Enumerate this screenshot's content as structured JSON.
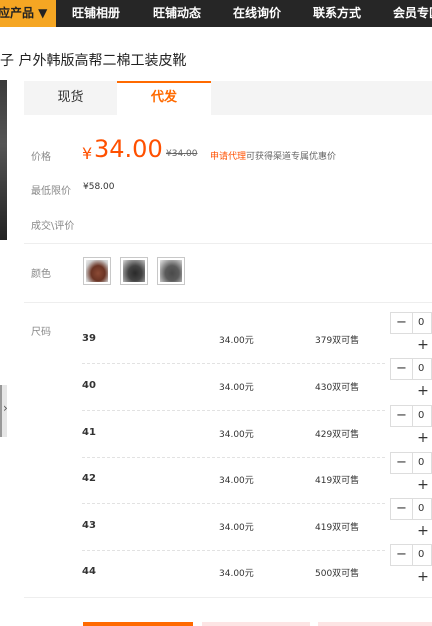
{
  "nav": {
    "items": [
      "应产品 ▼",
      "旺铺相册",
      "旺铺动态",
      "在线询价",
      "联系方式",
      "会员专区"
    ]
  },
  "product": {
    "title": "子 户外韩版高帮二棉工装皮靴"
  },
  "tabs": [
    "现货",
    "代发"
  ],
  "labels": {
    "price": "价格",
    "min_price": "最低限价",
    "deals": "成交\\评价",
    "color": "颜色",
    "size": "尺码"
  },
  "price": {
    "currency": "¥",
    "value": "34.00",
    "old": "¥34.00",
    "promo_link": "申请代理",
    "promo_text": "可获得渠道专属优惠价"
  },
  "min_price": "¥58.00",
  "sizes": [
    {
      "size": "39",
      "price": "34.00元",
      "stock": "379双可售",
      "qty": "0"
    },
    {
      "size": "40",
      "price": "34.00元",
      "stock": "430双可售",
      "qty": "0"
    },
    {
      "size": "41",
      "price": "34.00元",
      "stock": "429双可售",
      "qty": "0"
    },
    {
      "size": "42",
      "price": "34.00元",
      "stock": "419双可售",
      "qty": "0"
    },
    {
      "size": "43",
      "price": "34.00元",
      "stock": "419双可售",
      "qty": "0"
    },
    {
      "size": "44",
      "price": "34.00元",
      "stock": "500双可售",
      "qty": "0"
    }
  ],
  "stepper": {
    "minus": "−",
    "plus": "+"
  },
  "colors": {
    "accent": "#ff5000",
    "tab_accent": "#ff6a00",
    "nav_bg": "#262626",
    "nav_first_bg": "#f5a623"
  },
  "icons": {
    "prev_image": "chevron-right-icon"
  }
}
